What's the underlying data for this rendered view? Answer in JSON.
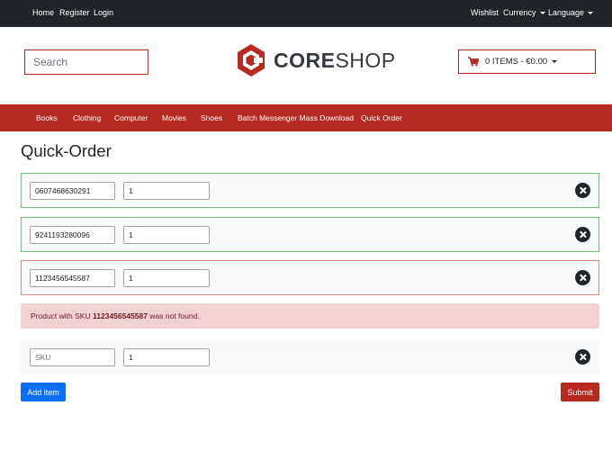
{
  "topbar": {
    "left_links": [
      "Home",
      "Register",
      "Login"
    ],
    "right_links": [
      {
        "label": "Wishlist",
        "dropdown": false
      },
      {
        "label": "Currency",
        "dropdown": true
      },
      {
        "label": "Language",
        "dropdown": true
      }
    ]
  },
  "header": {
    "search_placeholder": "Search",
    "logo": {
      "part1": "CORE",
      "part2": "SHOP"
    },
    "cart_label": "0 ITEMS - €0.00",
    "cart_icon": "shopping-cart-icon"
  },
  "nav": {
    "items": [
      "Books",
      "Clothing",
      "Computer",
      "Movies",
      "Shoes",
      "Batch Messenger Mass Download",
      "Quick Order"
    ]
  },
  "page": {
    "title": "Quick-Order"
  },
  "order_rows": [
    {
      "sku": "0607468630291",
      "quantity": "1",
      "status": "valid"
    },
    {
      "sku": "9241193280096",
      "quantity": "1",
      "status": "valid"
    },
    {
      "sku": "1123456545587",
      "quantity": "1",
      "status": "invalid"
    }
  ],
  "error": {
    "prefix": "Product with SKU",
    "sku": "1123456545587",
    "suffix": "was not found."
  },
  "new_row": {
    "sku_placeholder": "SKU",
    "quantity": "1"
  },
  "actions": {
    "add_label": "Add item",
    "submit_label": "Submit"
  },
  "colors": {
    "brand": "#b8291f",
    "topbar": "#212529",
    "primary": "#0d6efd",
    "valid_border": "#6ec47a",
    "invalid_border": "#e08a86",
    "alert_bg": "#f2d1d2"
  }
}
